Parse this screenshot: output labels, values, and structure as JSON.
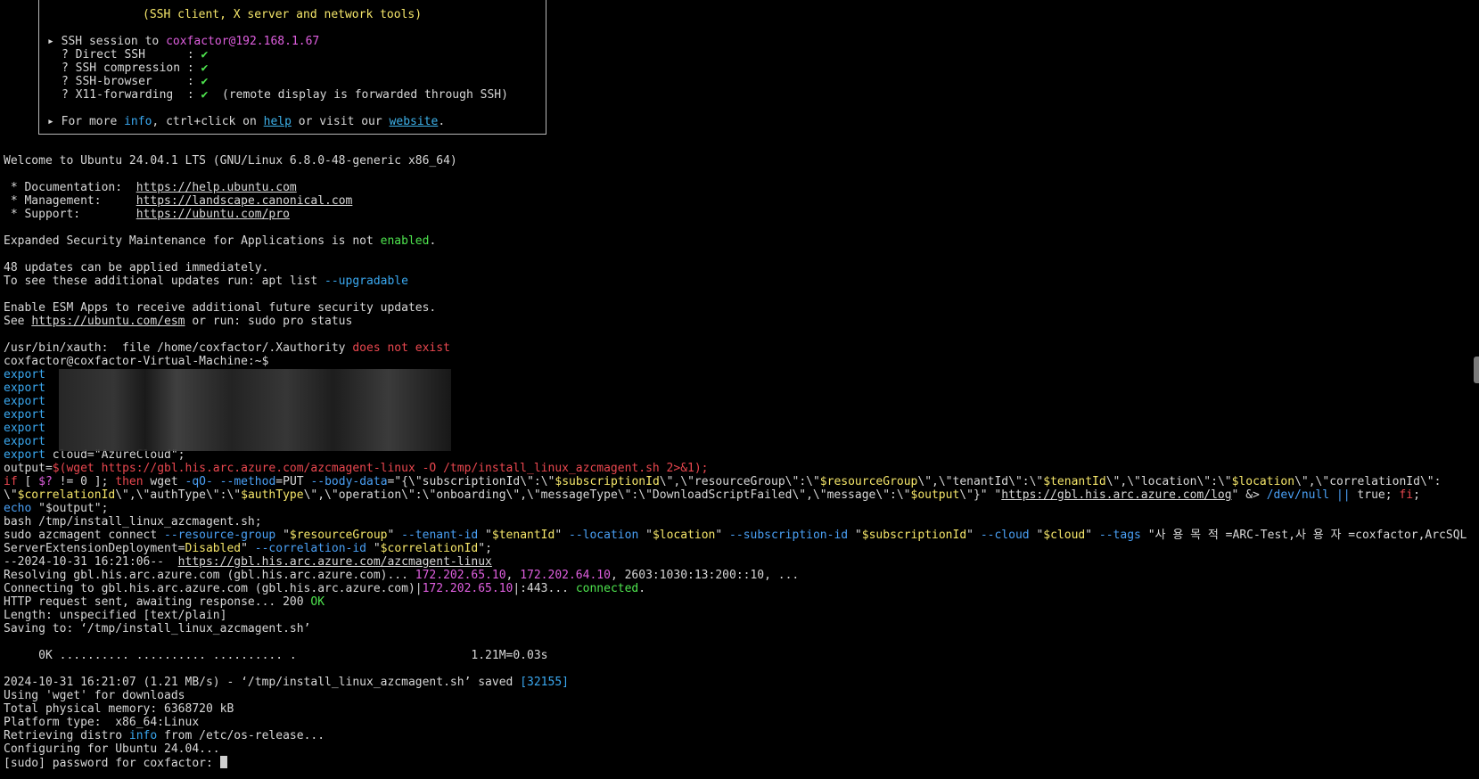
{
  "banner": {
    "subtitle": "(SSH client, X server and network tools)",
    "session_prefix": "SSH session to ",
    "session_target": "coxfactor@192.168.1.67",
    "features": [
      {
        "label": "? Direct SSH      :",
        "check": "✔",
        "note": ""
      },
      {
        "label": "? SSH compression :",
        "check": "✔",
        "note": ""
      },
      {
        "label": "? SSH-browser     :",
        "check": "✔",
        "note": ""
      },
      {
        "label": "? X11-forwarding  :",
        "check": "✔",
        "note": "  (remote display is forwarded through SSH)"
      }
    ],
    "more_prefix": "For more ",
    "more_info": "info",
    "more_mid": ", ctrl+click on ",
    "more_help": "help",
    "more_or": " or visit our ",
    "more_website": "website",
    "more_end": "."
  },
  "motd": {
    "welcome": "Welcome to Ubuntu 24.04.1 LTS (GNU/Linux 6.8.0-48-generic x86_64)",
    "doc_label": " * Documentation:  ",
    "doc_url": "https://help.ubuntu.com",
    "mgmt_label": " * Management:     ",
    "mgmt_url": "https://landscape.canonical.com",
    "support_label": " * Support:        ",
    "support_url": "https://ubuntu.com/pro",
    "esm_text": "Expanded Security Maintenance for Applications is not ",
    "esm_enabled": "enabled",
    "esm_end": ".",
    "updates1": "48 updates can be applied immediately.",
    "updates2_prefix": "To see these additional updates run: apt list ",
    "updates2_flag": "--upgradable",
    "esm_apps": "Enable ESM Apps to receive additional future security updates.",
    "see_prefix": "See ",
    "see_url": "https://ubuntu.com/esm",
    "see_suffix": " or run: sudo pro status",
    "xauth_prefix": "/usr/bin/xauth:  file /home/coxfactor/.Xauthority ",
    "xauth_err": "does not exist",
    "prompt": "coxfactor@coxfactor-Virtual-Machine:~$"
  },
  "exports": {
    "keyword": "export",
    "cloud_line": "export cloud=\"AzureCloud\";"
  },
  "script": {
    "output_prefix": "output=",
    "output_cmd": "$(wget https://gbl.his.arc.azure.com/azcmagent-linux -O /tmp/install_linux_azcmagent.sh 2>&1);",
    "if_a": "if",
    "if_b": " [ ",
    "if_c": "$?",
    "if_d": " != 0 ]; ",
    "if_then": "then",
    "if_e": " wget ",
    "if_qo": "-qO-",
    "if_f": " ",
    "if_method": "--method",
    "if_g": "=PUT ",
    "if_body": "--body-data",
    "if_h": "=\"{\\\"subscriptionId\\\":\\\"",
    "if_sub": "$subscriptionId",
    "if_i": "\\\",\\\"resourceGroup\\\":\\\"",
    "if_rg": "$resourceGroup",
    "if_j": "\\\",\\\"tenantId\\\":\\\"",
    "if_tid": "$tenantId",
    "if_k": "\\\",\\\"location\\\":\\\"",
    "if_loc": "$location",
    "if_l": "\\\",\\\"correlationId\\\":",
    "l2_a": "\\\"",
    "l2_corr": "$correlationId",
    "l2_b": "\\\",\\\"authType\\\":\\\"",
    "l2_auth": "$authType",
    "l2_c": "\\\",\\\"operation\\\":\\\"onboarding\\\",\\\"messageType\\\":\\\"DownloadScriptFailed\\\",\\\"message\\\":\\\"",
    "l2_out": "$output",
    "l2_d": "\\\"}\" \"",
    "l2_url": "https://gbl.his.arc.azure.com/log",
    "l2_e": "\" &> ",
    "l2_null": "/dev/null ||",
    "l2_f": " true; ",
    "l2_fi": "fi",
    "l2_g": ";",
    "echo_kw": "echo",
    "echo_rest": " \"$output\";",
    "bash_line": "bash /tmp/install_linux_azcmagent.sh;",
    "sudo_a": "sudo azcmagent connect ",
    "sudo_rg_flag": "--resource-group",
    "sudo_b": " \"",
    "sudo_rg": "$resourceGroup",
    "sudo_c": "\" ",
    "sudo_tid_flag": "--tenant-id",
    "sudo_d": " \"",
    "sudo_tid": "$tenantId",
    "sudo_e": "\" ",
    "sudo_loc_flag": "--location",
    "sudo_f": " \"",
    "sudo_loc": "$location",
    "sudo_g": "\" ",
    "sudo_sub_flag": "--subscription-id",
    "sudo_h": " \"",
    "sudo_sub": "$subscriptionId",
    "sudo_i": "\" ",
    "sudo_cloud_flag": "--cloud",
    "sudo_j": " \"",
    "sudo_cloud": "$cloud",
    "sudo_k": "\" ",
    "sudo_tags_flag": "--tags",
    "sudo_l": " \"사 용 목 적 =ARC-Test,사 용 자 =coxfactor,ArcSQL",
    "l3_a": "ServerExtensionDeployment=",
    "l3_disabled": "Disabled",
    "l3_b": "\" ",
    "l3_corr_flag": "--correlation-id",
    "l3_c": " \"",
    "l3_corr": "$correlationId",
    "l3_d": "\";"
  },
  "wget": {
    "date_prefix": "--2024-10-31 16:21:06--  ",
    "date_url": "https://gbl.his.arc.azure.com/azcmagent-linux",
    "resolving_a": "Resolving gbl.his.arc.azure.com (gbl.his.arc.azure.com)... ",
    "ip1": "172.202.65.10",
    "resolving_b": ", ",
    "ip2": "172.202.64.10",
    "resolving_c": ", 2603:1030:13:200::10, ...",
    "connecting_a": "Connecting to gbl.his.arc.azure.com (gbl.his.arc.azure.com)|",
    "connecting_ip": "172.202.65.10",
    "connecting_b": "|:443... ",
    "connected": "connected",
    "connecting_c": ".",
    "http_a": "HTTP request sent, awaiting response... 200 ",
    "http_ok": "OK",
    "length": "Length: unspecified [text/plain]",
    "saving": "Saving to: ‘/tmp/install_linux_azcmagent.sh’",
    "progress": "     0K .......... .......... .......... .                         1.21M=0.03s",
    "saved_a": "2024-10-31 16:21:07 (1.21 MB/s) - ‘/tmp/install_linux_azcmagent.sh’ saved ",
    "saved_count": "[32155]",
    "using": "Using 'wget' for downloads",
    "memory": "Total physical memory: 6368720 kB",
    "platform": "Platform type:  x86_64:Linux",
    "retrieving_a": "Retrieving distro ",
    "retrieving_info": "info",
    "retrieving_b": " from /etc/os-release...",
    "configuring": "Configuring for Ubuntu 24.04...",
    "sudo_prompt": "[sudo] password for coxfactor: "
  },
  "colors": {
    "background": "#000000",
    "text": "#d8d8d8",
    "yellow": "#f5e66a",
    "magenta": "#e05fe0",
    "green": "#4ee44e",
    "cyan": "#3aa8f0",
    "red": "#e9474f"
  }
}
